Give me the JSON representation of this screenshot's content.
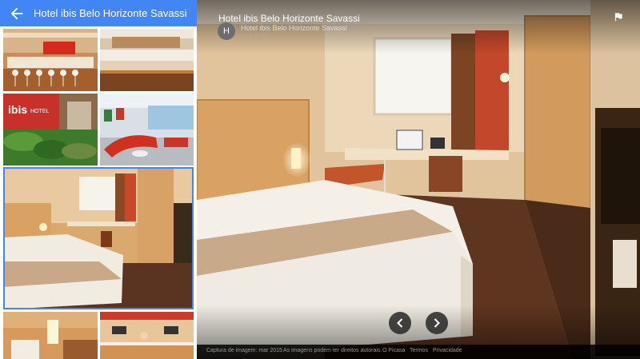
{
  "app": {
    "title": "Hotel ibis Belo Horizonte Savassi"
  },
  "viewer": {
    "title": "Hotel ibis Belo Horizonte Savassi",
    "contributor_initial": "H",
    "contributor": "Hotel ibis Belo Horizonte Savassi",
    "date": "MAR 2015"
  },
  "footer": {
    "capture": "Captura de imagem: mar 2015",
    "rights": "As imagens podem ter direitos autorais.",
    "feedback": "O Picasa",
    "terms": "Termos",
    "privacy": "Privacidade"
  },
  "thumbnails": [
    "restaurant-bar",
    "breakfast-buffet",
    "ibis-lobby-sign",
    "lobby-lounge",
    "guest-room",
    "bathroom",
    "reception"
  ],
  "icons": {
    "back": "arrow-left-icon",
    "collapse": "chevron-left-icon",
    "flag": "flag-icon",
    "prev": "chevron-left-icon",
    "next": "chevron-right-icon"
  },
  "colors": {
    "accent": "#4285f4",
    "viewer_bg": "#000000"
  }
}
